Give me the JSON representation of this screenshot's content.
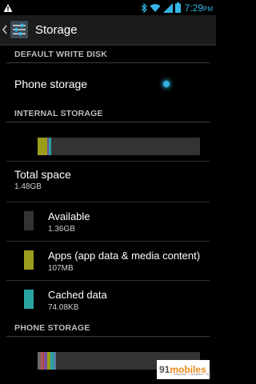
{
  "status_bar": {
    "time": "7:29",
    "ampm": "PM",
    "icons": [
      "warning-icon",
      "bluetooth-icon",
      "wifi-icon",
      "signal-icon",
      "battery-icon"
    ]
  },
  "action_bar": {
    "title": "Storage",
    "icons": [
      "back-chevron-icon",
      "settings-sliders-icon"
    ]
  },
  "default_write_disk": {
    "header": "DEFAULT WRITE DISK",
    "option_label": "Phone storage",
    "selected": true
  },
  "internal_storage": {
    "header": "INTERNAL STORAGE",
    "total_label": "Total space",
    "total_value": "1.48GB",
    "items": [
      {
        "label": "Available",
        "value": "1.36GB",
        "color": "#333333"
      },
      {
        "label": "Apps (app data & media content)",
        "value": "107MB",
        "color": "#9a9e1a"
      },
      {
        "label": "Cached data",
        "value": "74.08KB",
        "color": "#2aa3a3"
      }
    ]
  },
  "phone_storage": {
    "header": "PHONE STORAGE"
  },
  "watermark": {
    "brand_number": "91",
    "brand_name": "mobiles",
    "tagline": "Discover · Compare · Buy"
  },
  "colors": {
    "accent": "#33b5e5",
    "apps": "#9a9e1a",
    "cached": "#2aa3a3",
    "available": "#333333"
  }
}
